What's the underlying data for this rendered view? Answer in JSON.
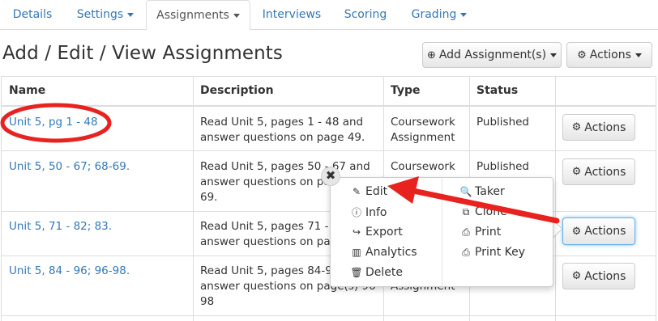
{
  "tabs": [
    {
      "label": "Details"
    },
    {
      "label": "Settings"
    },
    {
      "label": "Assignments"
    },
    {
      "label": "Interviews"
    },
    {
      "label": "Scoring"
    },
    {
      "label": "Grading"
    }
  ],
  "page_title": "Add / Edit / View Assignments",
  "toolbar": {
    "add_label": "Add Assignment(s)",
    "actions_label": "Actions"
  },
  "table": {
    "headers": [
      "Name",
      "Description",
      "Type",
      "Status"
    ],
    "rows": [
      {
        "name": "Unit 5, pg 1 - 48",
        "desc": [
          "Read Unit 5, pages 1 - 48 and",
          "answer questions on page 49."
        ],
        "type": [
          "Coursework",
          "Assignment"
        ],
        "status": "Published",
        "action": "Actions"
      },
      {
        "name": "Unit 5, 50 - 67; 68-69.",
        "desc": [
          "Read Unit 5, pages 50 - 67 and",
          "answer questions on page",
          "69."
        ],
        "type": [
          "Coursework",
          ""
        ],
        "status": "Published",
        "action": "Actions"
      },
      {
        "name": "Unit 5, 71 - 82; 83.",
        "desc": [
          "Read Unit 5, pages 71 - 82",
          "answer questions on page"
        ],
        "type": [
          "",
          ""
        ],
        "status": "",
        "action": "Actions"
      },
      {
        "name": "Unit 5, 84 - 96; 96-98.",
        "desc": [
          "Read Unit 5, pages 84-96",
          "answer questions on page(s) 96-",
          "98"
        ],
        "type": [
          "",
          "Assignment"
        ],
        "status": "",
        "action": "Actions"
      }
    ]
  },
  "menu": {
    "left": [
      {
        "icon": "pencil-icon",
        "label": "Edit"
      },
      {
        "icon": "info-icon",
        "label": "Info"
      },
      {
        "icon": "share-icon",
        "label": "Export"
      },
      {
        "icon": "chart-icon",
        "label": "Analytics"
      },
      {
        "icon": "trash-icon",
        "label": "Delete"
      }
    ],
    "right": [
      {
        "icon": "search-icon",
        "label": "Taker"
      },
      {
        "icon": "copy-icon",
        "label": "Clone"
      },
      {
        "icon": "print-icon",
        "label": "Print"
      },
      {
        "icon": "print-icon",
        "label": "Print Key"
      }
    ]
  },
  "colors": {
    "link": "#3478b6",
    "annotation_red": "#e8231f"
  }
}
